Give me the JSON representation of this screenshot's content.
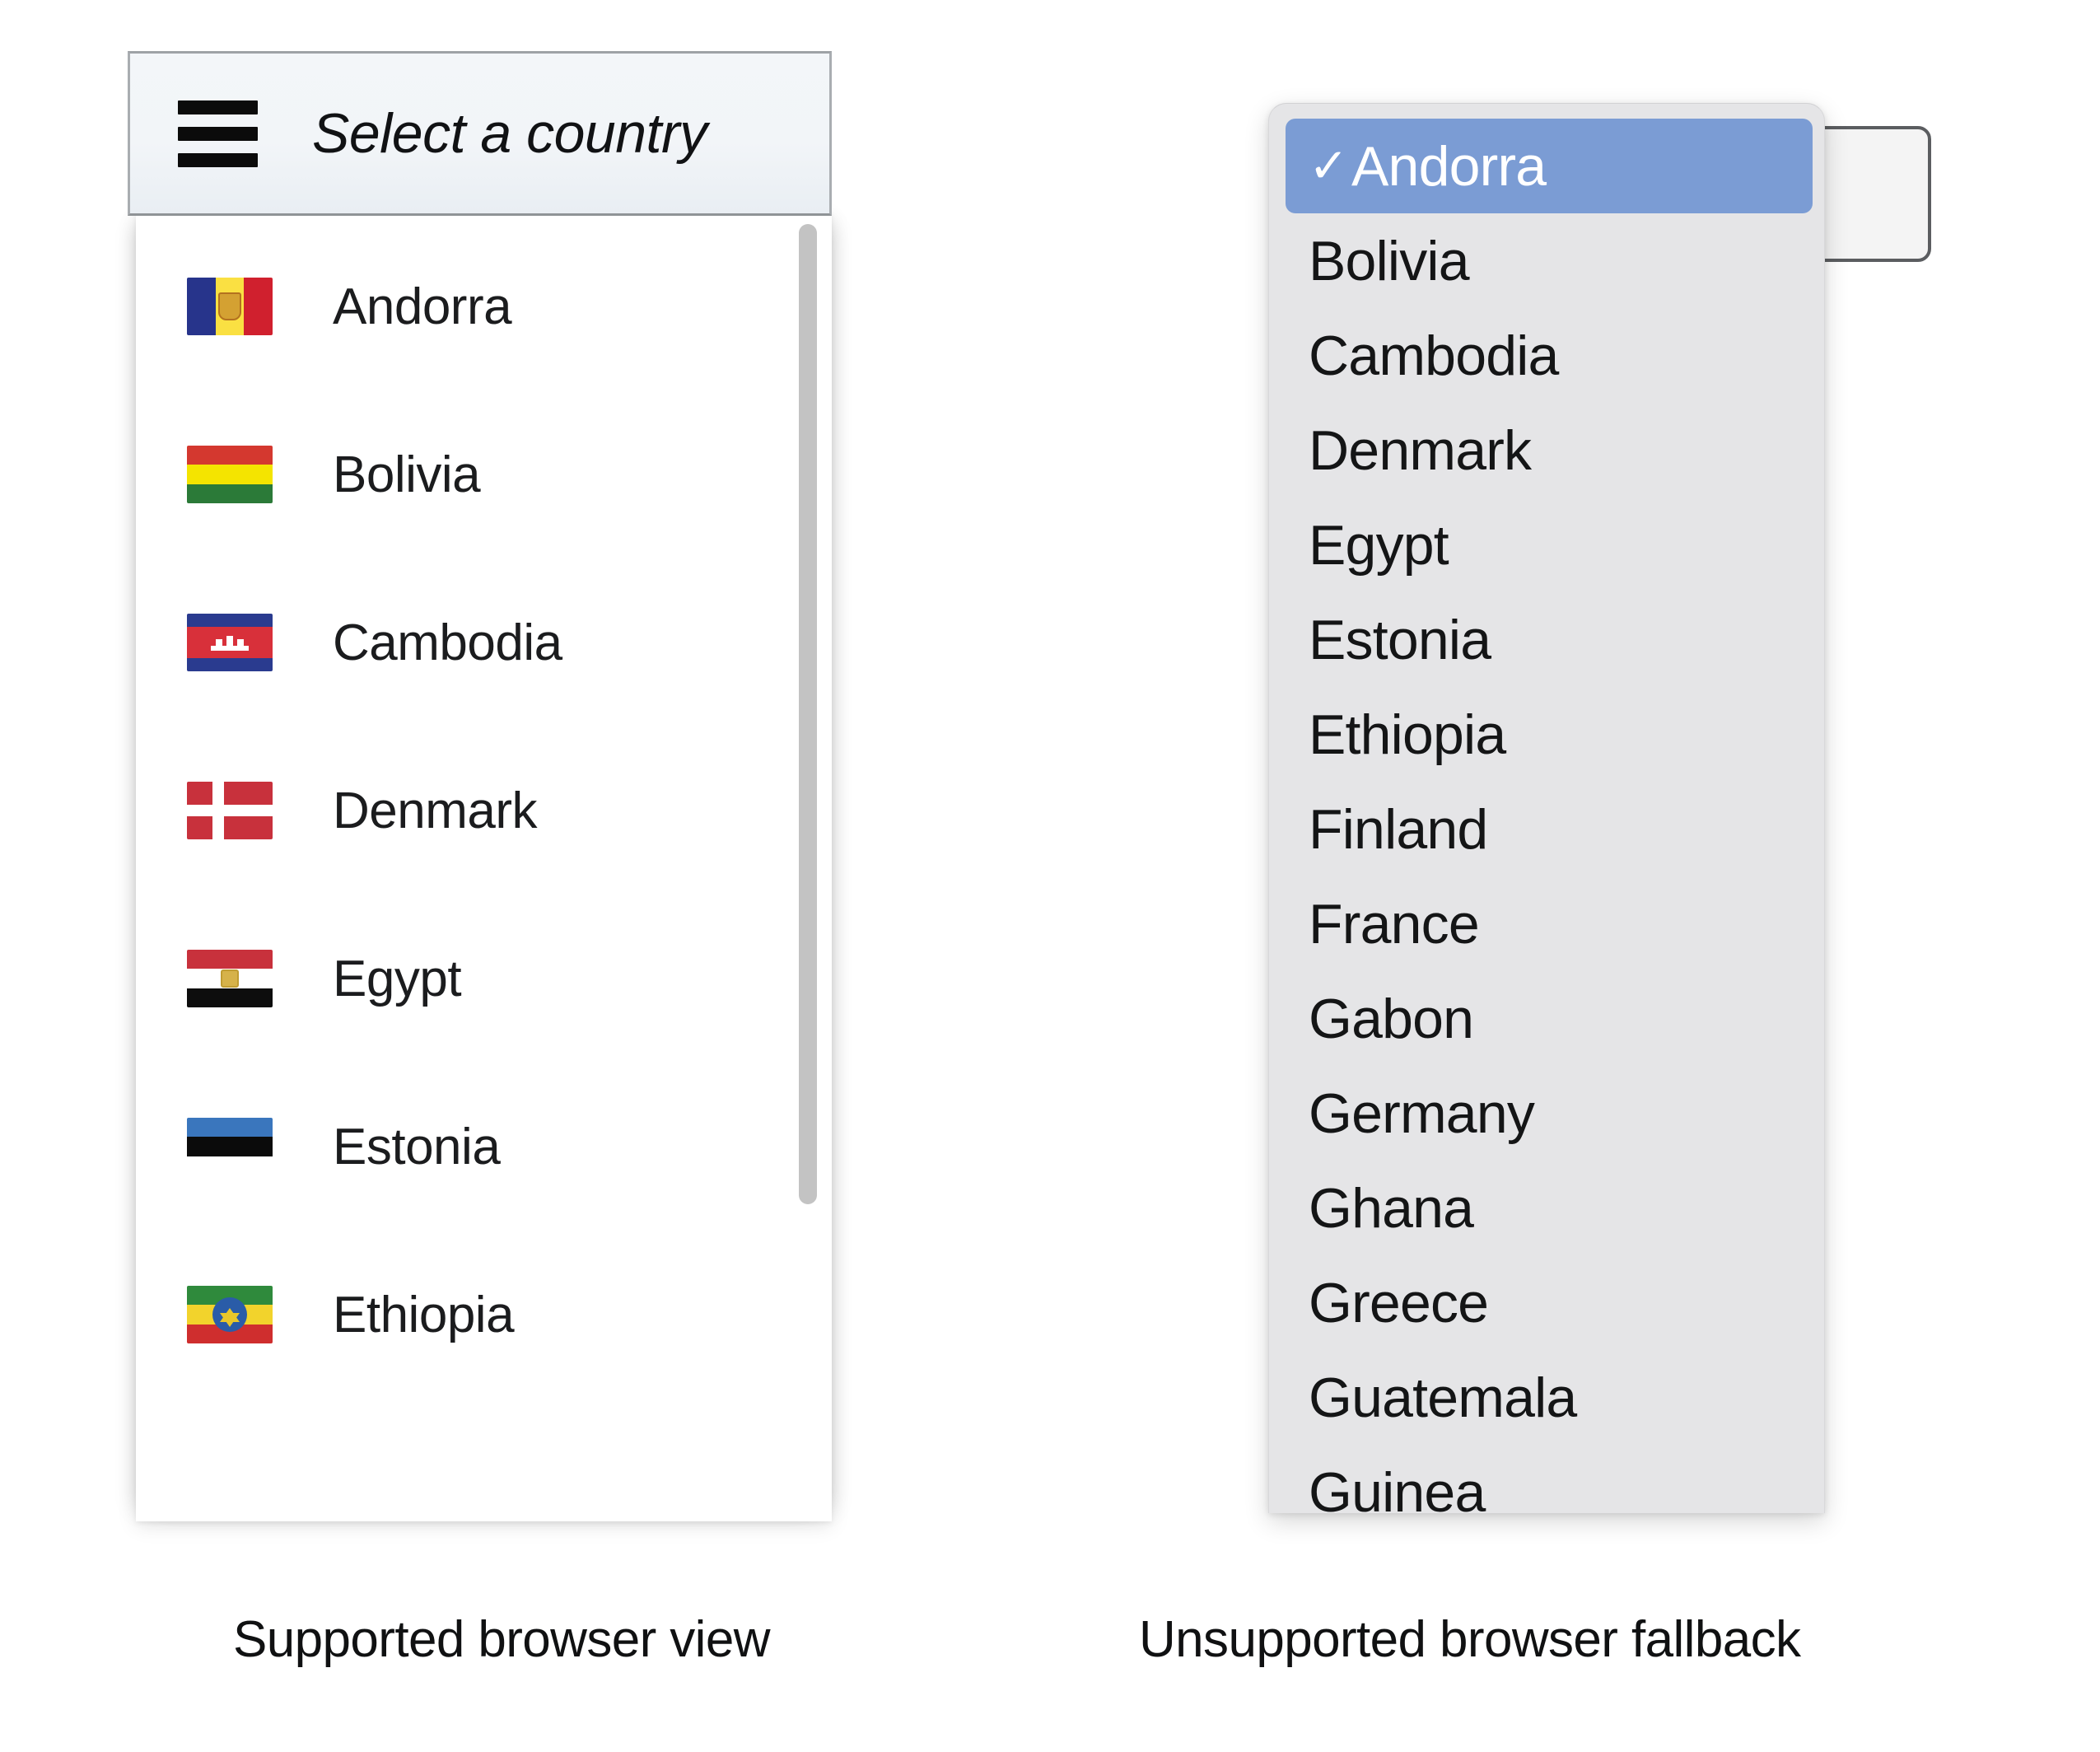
{
  "supported": {
    "caption": "Supported browser view",
    "select_button": {
      "label": "Select a country",
      "icon": "hamburger-menu-icon"
    },
    "countries": [
      {
        "name": "Andorra",
        "flag": "andorra-flag"
      },
      {
        "name": "Bolivia",
        "flag": "bolivia-flag"
      },
      {
        "name": "Cambodia",
        "flag": "cambodia-flag"
      },
      {
        "name": "Denmark",
        "flag": "denmark-flag"
      },
      {
        "name": "Egypt",
        "flag": "egypt-flag"
      },
      {
        "name": "Estonia",
        "flag": "estonia-flag"
      },
      {
        "name": "Ethiopia",
        "flag": "ethiopia-flag"
      }
    ]
  },
  "fallback": {
    "caption": "Unsupported browser fallback",
    "selected_value": "Andorra",
    "checkmark": "✓",
    "native_select_arrow": "⌄",
    "options": [
      "Andorra",
      "Bolivia",
      "Cambodia",
      "Denmark",
      "Egypt",
      "Estonia",
      "Ethiopia",
      "Finland",
      "France",
      "Gabon",
      "Germany",
      "Ghana",
      "Greece",
      "Guatemala",
      "Guinea"
    ]
  },
  "colors": {
    "selection_blue": "#7b9cd4",
    "dropdown_background": "#e5e5e7",
    "button_background": "#f2f5f8",
    "page_background": "#ffffff",
    "scrollbar_thumb": "#c3c3c3"
  }
}
